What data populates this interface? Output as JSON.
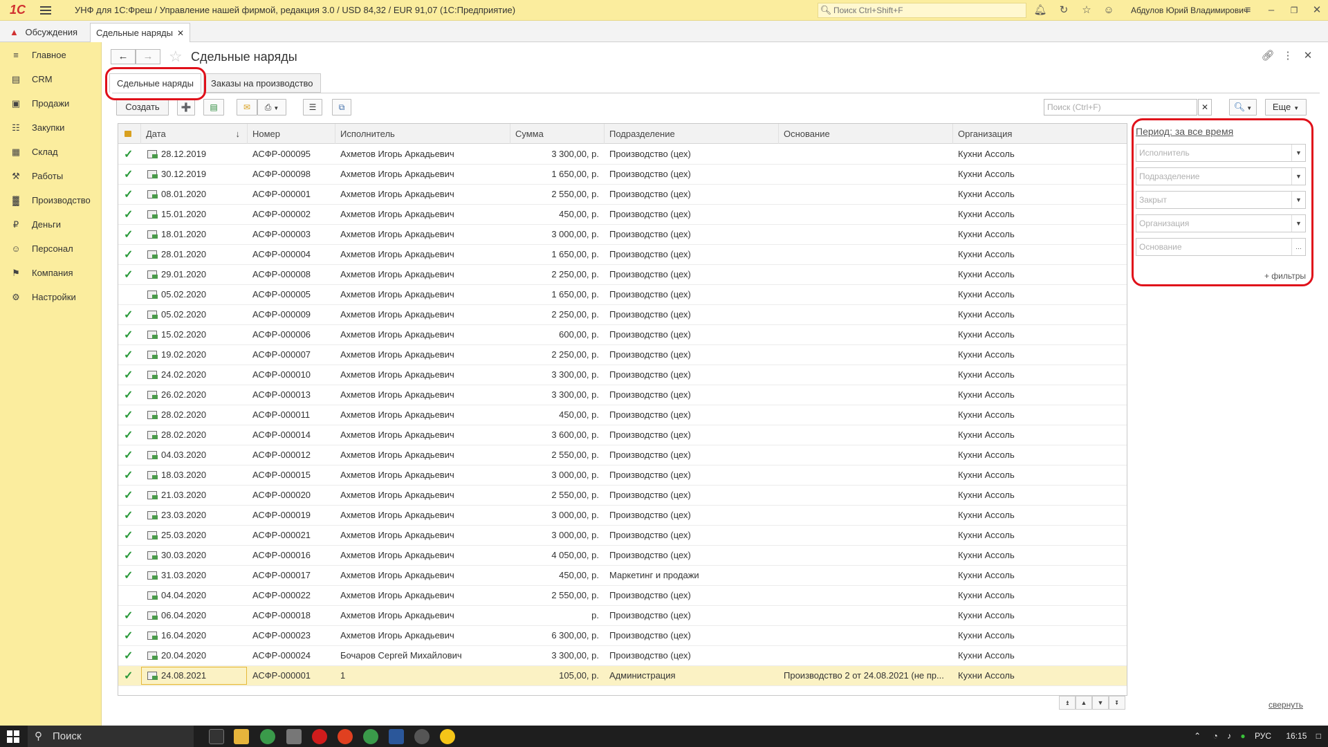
{
  "titlebar": {
    "logo": "1С",
    "title": "УНФ для 1С:Фреш / Управление нашей фирмой, редакция 3.0 / USD 84,32 / EUR 91,07  (1С:Предприятие)",
    "search_placeholder": "Поиск Ctrl+Shift+F",
    "user": "Абдулов Юрий Владимирович"
  },
  "open_tabs": {
    "discussions": "Обсуждения",
    "current": "Сдельные наряды"
  },
  "sidebar": {
    "items": [
      {
        "label": "Главное",
        "icon": "menu-icon"
      },
      {
        "label": "CRM",
        "icon": "crm-icon"
      },
      {
        "label": "Продажи",
        "icon": "sales-icon"
      },
      {
        "label": "Закупки",
        "icon": "purchases-icon"
      },
      {
        "label": "Склад",
        "icon": "warehouse-icon"
      },
      {
        "label": "Работы",
        "icon": "works-icon"
      },
      {
        "label": "Производство",
        "icon": "production-icon"
      },
      {
        "label": "Деньги",
        "icon": "money-icon"
      },
      {
        "label": "Персонал",
        "icon": "staff-icon"
      },
      {
        "label": "Компания",
        "icon": "company-icon"
      },
      {
        "label": "Настройки",
        "icon": "settings-icon"
      }
    ]
  },
  "page": {
    "title": "Сдельные наряды",
    "tabs": [
      "Сдельные наряды",
      "Заказы на производство"
    ],
    "create_label": "Создать",
    "search_placeholder": "Поиск (Ctrl+F)",
    "more_label": "Еще",
    "collapse_label": "свернуть"
  },
  "table": {
    "columns": [
      "Дата",
      "Номер",
      "Исполнитель",
      "Сумма",
      "Подразделение",
      "Основание",
      "Организация"
    ],
    "rows": [
      {
        "checked": true,
        "date": "28.12.2019",
        "number": "АСФР-000095",
        "executor": "Ахметов Игорь Аркадьевич",
        "sum": "3 300,00, р.",
        "dept": "Производство (цех)",
        "basis": "",
        "org": "Кухни Ассоль"
      },
      {
        "checked": true,
        "date": "30.12.2019",
        "number": "АСФР-000098",
        "executor": "Ахметов Игорь Аркадьевич",
        "sum": "1 650,00, р.",
        "dept": "Производство (цех)",
        "basis": "",
        "org": "Кухни Ассоль"
      },
      {
        "checked": true,
        "date": "08.01.2020",
        "number": "АСФР-000001",
        "executor": "Ахметов Игорь Аркадьевич",
        "sum": "2 550,00, р.",
        "dept": "Производство (цех)",
        "basis": "",
        "org": "Кухни Ассоль"
      },
      {
        "checked": true,
        "date": "15.01.2020",
        "number": "АСФР-000002",
        "executor": "Ахметов Игорь Аркадьевич",
        "sum": "450,00, р.",
        "dept": "Производство (цех)",
        "basis": "",
        "org": "Кухни Ассоль"
      },
      {
        "checked": true,
        "date": "18.01.2020",
        "number": "АСФР-000003",
        "executor": "Ахметов Игорь Аркадьевич",
        "sum": "3 000,00, р.",
        "dept": "Производство (цех)",
        "basis": "",
        "org": "Кухни Ассоль"
      },
      {
        "checked": true,
        "date": "28.01.2020",
        "number": "АСФР-000004",
        "executor": "Ахметов Игорь Аркадьевич",
        "sum": "1 650,00, р.",
        "dept": "Производство (цех)",
        "basis": "",
        "org": "Кухни Ассоль"
      },
      {
        "checked": true,
        "date": "29.01.2020",
        "number": "АСФР-000008",
        "executor": "Ахметов Игорь Аркадьевич",
        "sum": "2 250,00, р.",
        "dept": "Производство (цех)",
        "basis": "",
        "org": "Кухни Ассоль"
      },
      {
        "checked": false,
        "date": "05.02.2020",
        "number": "АСФР-000005",
        "executor": "Ахметов Игорь Аркадьевич",
        "sum": "1 650,00, р.",
        "dept": "Производство (цех)",
        "basis": "",
        "org": "Кухни Ассоль"
      },
      {
        "checked": true,
        "date": "05.02.2020",
        "number": "АСФР-000009",
        "executor": "Ахметов Игорь Аркадьевич",
        "sum": "2 250,00, р.",
        "dept": "Производство (цех)",
        "basis": "",
        "org": "Кухни Ассоль"
      },
      {
        "checked": true,
        "date": "15.02.2020",
        "number": "АСФР-000006",
        "executor": "Ахметов Игорь Аркадьевич",
        "sum": "600,00, р.",
        "dept": "Производство (цех)",
        "basis": "",
        "org": "Кухни Ассоль"
      },
      {
        "checked": true,
        "date": "19.02.2020",
        "number": "АСФР-000007",
        "executor": "Ахметов Игорь Аркадьевич",
        "sum": "2 250,00, р.",
        "dept": "Производство (цех)",
        "basis": "",
        "org": "Кухни Ассоль"
      },
      {
        "checked": true,
        "date": "24.02.2020",
        "number": "АСФР-000010",
        "executor": "Ахметов Игорь Аркадьевич",
        "sum": "3 300,00, р.",
        "dept": "Производство (цех)",
        "basis": "",
        "org": "Кухни Ассоль"
      },
      {
        "checked": true,
        "date": "26.02.2020",
        "number": "АСФР-000013",
        "executor": "Ахметов Игорь Аркадьевич",
        "sum": "3 300,00, р.",
        "dept": "Производство (цех)",
        "basis": "",
        "org": "Кухни Ассоль"
      },
      {
        "checked": true,
        "date": "28.02.2020",
        "number": "АСФР-000011",
        "executor": "Ахметов Игорь Аркадьевич",
        "sum": "450,00, р.",
        "dept": "Производство (цех)",
        "basis": "",
        "org": "Кухни Ассоль"
      },
      {
        "checked": true,
        "date": "28.02.2020",
        "number": "АСФР-000014",
        "executor": "Ахметов Игорь Аркадьевич",
        "sum": "3 600,00, р.",
        "dept": "Производство (цех)",
        "basis": "",
        "org": "Кухни Ассоль"
      },
      {
        "checked": true,
        "date": "04.03.2020",
        "number": "АСФР-000012",
        "executor": "Ахметов Игорь Аркадьевич",
        "sum": "2 550,00, р.",
        "dept": "Производство (цех)",
        "basis": "",
        "org": "Кухни Ассоль"
      },
      {
        "checked": true,
        "date": "18.03.2020",
        "number": "АСФР-000015",
        "executor": "Ахметов Игорь Аркадьевич",
        "sum": "3 000,00, р.",
        "dept": "Производство (цех)",
        "basis": "",
        "org": "Кухни Ассоль"
      },
      {
        "checked": true,
        "date": "21.03.2020",
        "number": "АСФР-000020",
        "executor": "Ахметов Игорь Аркадьевич",
        "sum": "2 550,00, р.",
        "dept": "Производство (цех)",
        "basis": "",
        "org": "Кухни Ассоль"
      },
      {
        "checked": true,
        "date": "23.03.2020",
        "number": "АСФР-000019",
        "executor": "Ахметов Игорь Аркадьевич",
        "sum": "3 000,00, р.",
        "dept": "Производство (цех)",
        "basis": "",
        "org": "Кухни Ассоль"
      },
      {
        "checked": true,
        "date": "25.03.2020",
        "number": "АСФР-000021",
        "executor": "Ахметов Игорь Аркадьевич",
        "sum": "3 000,00, р.",
        "dept": "Производство (цех)",
        "basis": "",
        "org": "Кухни Ассоль"
      },
      {
        "checked": true,
        "date": "30.03.2020",
        "number": "АСФР-000016",
        "executor": "Ахметов Игорь Аркадьевич",
        "sum": "4 050,00, р.",
        "dept": "Производство (цех)",
        "basis": "",
        "org": "Кухни Ассоль"
      },
      {
        "checked": true,
        "date": "31.03.2020",
        "number": "АСФР-000017",
        "executor": "Ахметов Игорь Аркадьевич",
        "sum": "450,00, р.",
        "dept": "Маркетинг и продажи",
        "basis": "",
        "org": "Кухни Ассоль"
      },
      {
        "checked": false,
        "date": "04.04.2020",
        "number": "АСФР-000022",
        "executor": "Ахметов Игорь Аркадьевич",
        "sum": "2 550,00, р.",
        "dept": "Производство (цех)",
        "basis": "",
        "org": "Кухни Ассоль"
      },
      {
        "checked": true,
        "date": "06.04.2020",
        "number": "АСФР-000018",
        "executor": "Ахметов Игорь Аркадьевич",
        "sum": "р.",
        "dept": "Производство (цех)",
        "basis": "",
        "org": "Кухни Ассоль"
      },
      {
        "checked": true,
        "date": "16.04.2020",
        "number": "АСФР-000023",
        "executor": "Ахметов Игорь Аркадьевич",
        "sum": "6 300,00, р.",
        "dept": "Производство (цех)",
        "basis": "",
        "org": "Кухни Ассоль"
      },
      {
        "checked": true,
        "date": "20.04.2020",
        "number": "АСФР-000024",
        "executor": "Бочаров Сергей Михайлович",
        "sum": "3 300,00, р.",
        "dept": "Производство (цех)",
        "basis": "",
        "org": "Кухни Ассоль"
      },
      {
        "checked": true,
        "date": "24.08.2021",
        "number": "АСФР-000001",
        "executor": "1",
        "sum": "105,00, р.",
        "dept": "Администрация",
        "basis": "Производство 2 от 24.08.2021 (не пр...",
        "org": "Кухни Ассоль",
        "selected": true
      }
    ]
  },
  "filters": {
    "period": "Период: за все время",
    "fields": [
      "Исполнитель",
      "Подразделение",
      "Закрыт",
      "Организация",
      "Основание"
    ],
    "more": "+ фильтры"
  },
  "taskbar": {
    "search": "Поиск",
    "lang": "РУС",
    "time": "16:15"
  },
  "colors": {
    "accent_yellow": "#fbed9e",
    "check_green": "#2a9a3a",
    "annotation_red": "#e0101a",
    "selected_row": "#fbf2c4"
  }
}
